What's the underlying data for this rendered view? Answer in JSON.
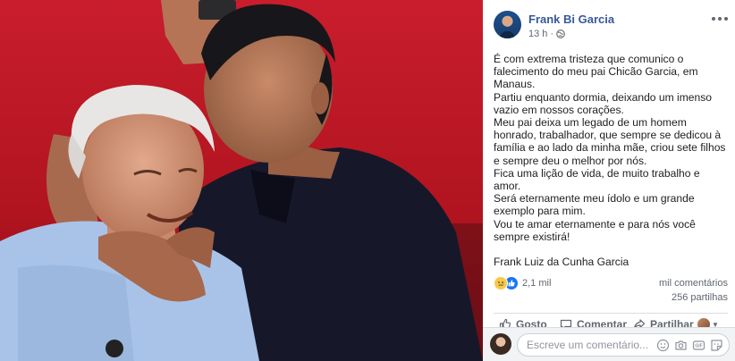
{
  "post": {
    "author": "Frank Bi Garcia",
    "time": "13 h",
    "separator": "·",
    "paragraphs": [
      "É com extrema tristeza que comunico o falecimento do meu pai Chicão Garcia, em Manaus.",
      "Partiu enquanto dormia, deixando um imenso vazio em nossos corações.",
      "Meu pai deixa um legado de um homem honrado, trabalhador, que sempre se dedicou à família e ao lado da minha mãe, criou sete filhos e sempre deu o melhor por nós.",
      "Fica uma lição de vida, de muito trabalho e amor.",
      "Será eternamente meu ídolo e um grande exemplo para mim.",
      "Vou te amar eternamente e para nós você sempre existirá!"
    ],
    "signature": "Frank Luiz da Cunha Garcia"
  },
  "stats": {
    "reactions_count": "2,1 mil",
    "reaction_icons": [
      "sad-emoji-icon",
      "like-thumb-icon"
    ],
    "comments": "mil comentários",
    "shares": "256 partilhas"
  },
  "actions": {
    "like": "Gosto",
    "comment": "Comentar",
    "share": "Partilhar"
  },
  "composer": {
    "placeholder": "Escreve um comentário..."
  },
  "colors": {
    "author_link": "#385898",
    "secondary_text": "#606770",
    "like_blue": "#1877f2",
    "photo_background": "#c21a2a"
  }
}
